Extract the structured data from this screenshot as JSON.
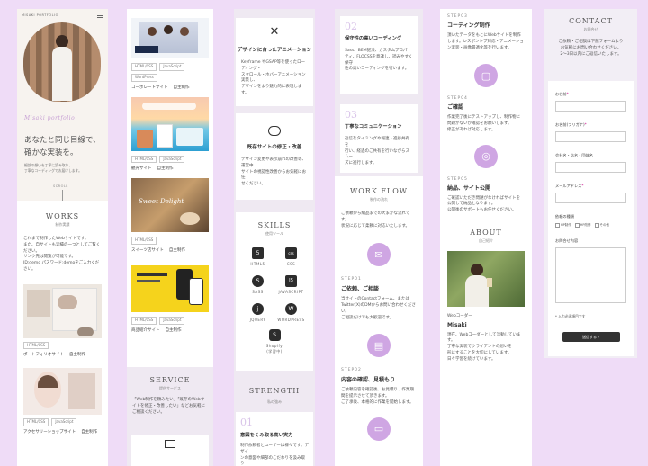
{
  "colors": {
    "background": "#efdcf7",
    "accent": "#cfa6e3",
    "accent_light": "#d9c4e9",
    "button_dark": "#333333"
  },
  "column1": {
    "logo": "MISAKI PORTFOLIO",
    "menu_icon": "hamburger-icon",
    "hero_script": "Misaki portfolio",
    "hero_title_1": "あなたと同じ目線で、",
    "hero_title_2": "確かな実装を。",
    "hero_text_1": "細部の想いを丁寧に読み取り、",
    "hero_text_2": "丁寧なコーディングでお届けします。",
    "scroll": "SCROLL",
    "works_title": "WORKS",
    "works_sub": "制作実績",
    "works_text_1": "これまで制作したWebサイトです。",
    "works_text_2": "また、自サイトも実績の一つとしてご覧ください。",
    "works_text_3": "リンク先は閲覧が可能です。",
    "works_text_4": "ID:demo パスワード:demoをご入力ください。",
    "item1_tags": [
      "HTML/CSS"
    ],
    "item1_name": "ポートフォリオサイト",
    "item1_type": "自主制作",
    "item2_tags": [
      "HTML/CSS",
      "JavaScript"
    ],
    "item2_name": "アクセサリーショップサイト",
    "item2_type": "自主制作"
  },
  "column2": {
    "item1_tags": [
      "HTML/CSS",
      "JavaScript",
      "WordPress"
    ],
    "item1_name": "コーポレートサイト",
    "item1_type": "自主制作",
    "item2_tags": [
      "HTML/CSS",
      "JavaScript"
    ],
    "item2_name": "観光サイト",
    "item2_type": "自主制作",
    "item3_tags": [
      "HTML/CSS"
    ],
    "item3_name": "スイーツ店サイト",
    "item3_type": "自主制作",
    "item4_tags": [
      "HTML/CSS",
      "JavaScript"
    ],
    "item4_name": "商品紹介サイト",
    "item4_type": "自主制作",
    "service_title": "SERVICE",
    "service_sub": "提供サービス",
    "service_text_1": "「Web制作を頼みたい」「既存のWebサ",
    "service_text_2": "イトを修正・改善したい」などお気軽に",
    "service_text_3": "ご相談ください。"
  },
  "column3": {
    "card1_icon": "tools-icon",
    "card1_title": "デザインに合ったアニメーション",
    "card1_text_1": "Keyframe やGSAP等を使ったローディング・",
    "card1_text_2": "スクロール・ホバーアニメーション実装し、",
    "card1_text_3": "デザインをより魅力的に表現します。",
    "card2_icon": "chat-icon",
    "card2_title": "既存サイトの修正・改善",
    "card2_text_1": "デザイン変更や表示崩れの改善等、運営中",
    "card2_text_2": "サイトの視認性改善からお気軽にお任",
    "card2_text_3": "せください。",
    "skills_title": "SKILLS",
    "skills_sub": "使用ツール",
    "skills": [
      {
        "icon": "html5-icon",
        "glyph": "5",
        "name": "HTML5"
      },
      {
        "icon": "css-icon",
        "glyph": "css",
        "name": "CSS"
      },
      {
        "icon": "sass-icon",
        "glyph": "S",
        "name": "SASS"
      },
      {
        "icon": "javascript-icon",
        "glyph": "JS",
        "name": "JAVASCRIPT"
      },
      {
        "icon": "jquery-icon",
        "glyph": "j",
        "name": "JQUERY"
      },
      {
        "icon": "wordpress-icon",
        "glyph": "W",
        "name": "WORDPRESS"
      }
    ],
    "shopify_name": "Shopify",
    "shopify_note": "(学習中)",
    "strength_title": "STRENGTH",
    "strength_sub": "私の強み",
    "strength1_num": "01",
    "strength1_title": "意図をくみ取る高い実力",
    "strength1_text_1": "制作依頼者とユーザーは様々です。デザイ",
    "strength1_text_2": "ンの意図や細部のこだわりを汲み取り"
  },
  "column4": {
    "s2_num": "02",
    "s2_title": "保守性の高いコーディング",
    "s2_text_1": "Sass、BEM記法、カスタムプロパ",
    "s2_text_2": "ティ、FLOCSSを意識し、読みやすく保守",
    "s2_text_3": "性の高いコーディングを行います。",
    "s3_num": "03",
    "s3_title": "丁寧なコミュニケーション",
    "s3_text_1": "返信をタイミングや報連・進捗共有を",
    "s3_text_2": "行い、経過のご共有を行いながらスムー",
    "s3_text_3": "ズに進行します。",
    "workflow_title": "WORK FLOW",
    "workflow_sub": "制作の流れ",
    "workflow_text_1": "ご依頼から納品までの大まかな流れです。",
    "workflow_text_2": "状況に応じて柔軟に対応いたします。",
    "step1_label": "STEP01",
    "step1_title": "ご依頼、ご相談",
    "step1_text_1": "当サイトのContactフォーム、または",
    "step1_text_2": "Twitter(X)のDMからお問い合わせください。",
    "step1_text_3": "ご相談だけでも大歓迎です。",
    "step1_icon": "mail-icon",
    "step2_label": "STEP02",
    "step2_title": "内容の確認、見積もり",
    "step2_text_1": "ご依頼内容を確認後、お見積り、作業期",
    "step2_text_2": "間を提示させて頂きます。",
    "step2_text_3": "ご了承後、本格的に作業を開始します。",
    "step2_icon": "document-icon",
    "step3_icon": "laptop-icon"
  },
  "column5": {
    "step3_label": "STEP03",
    "step3_title": "コーディング制作",
    "step3_text_1": "頂いたデータをもとにWebサイトを制作",
    "step3_text_2": "します。レスポンシブ対応・アニメーショ",
    "step3_text_3": "ン実装・画像最適化等を行います。",
    "step3_icon": "clipboard-icon",
    "step4_label": "STEP04",
    "step4_title": "ご確認",
    "step4_text_1": "作業完了後にテストアップし、制作物に",
    "step4_text_2": "問題がないか確認をお願いします。",
    "step4_text_3": "修正があれば対応します。",
    "step4_icon": "globe-icon",
    "step5_label": "STEP05",
    "step5_title": "納品、サイト公開",
    "step5_text_1": "ご確認いただき問題がなければサイトを",
    "step5_text_2": "公開して納品となります。",
    "step5_text_3": "公開後のサポートもお任せください。",
    "about_title": "ABOUT",
    "about_sub": "自己紹介",
    "about_role": "Webコーダー",
    "about_name": "Misaki",
    "about_text_1": "現在、Webコーダーとして活動しています。",
    "about_text_2": "丁寧な実装でクライアントの想いを",
    "about_text_3": "形にすることを大切にしています。",
    "about_text_4": "日々学習を続けています。"
  },
  "column6": {
    "contact_title": "CONTACT",
    "contact_sub": "お問合せ",
    "contact_text_1": "ご依頼・ご相談は下記フォームより",
    "contact_text_2": "お気軽にお問い合わせください。",
    "contact_text_3": "2〜3日以内にご返信いたします。",
    "name_label": "お名前",
    "kana_label": "お名前(フリガナ)",
    "company_label": "会社名・店名・団体名",
    "email_label": "メールアドレス",
    "purpose_label": "依頼の種類",
    "checkbox1": "HP制作",
    "checkbox2": "HP改修",
    "checkbox3": "その他",
    "message_label": "お問合せ内容",
    "required_note": "* 入力必須項目です",
    "submit_label": "送信する ›"
  }
}
